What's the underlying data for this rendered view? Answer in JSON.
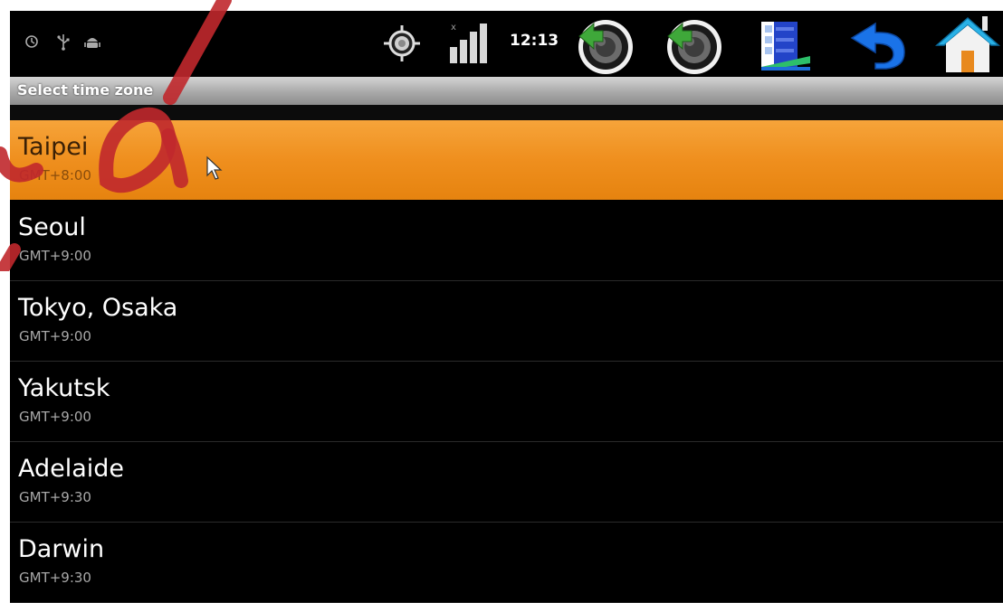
{
  "status_bar": {
    "left_icons": [
      "timer-icon",
      "usb-icon",
      "android-debug-icon"
    ],
    "right_icons": [
      "gps-target-icon",
      "signal-bars-icon"
    ],
    "time": "12:13",
    "actions": [
      "volume-down-icon",
      "volume-up-icon",
      "menu-icon",
      "back-icon",
      "home-icon"
    ]
  },
  "title_bar": {
    "title": "Select time zone"
  },
  "timezones": [
    {
      "name": "Taipei",
      "offset": "GMT+8:00",
      "selected": true
    },
    {
      "name": "Seoul",
      "offset": "GMT+9:00",
      "selected": false
    },
    {
      "name": "Tokyo, Osaka",
      "offset": "GMT+9:00",
      "selected": false
    },
    {
      "name": "Yakutsk",
      "offset": "GMT+9:00",
      "selected": false
    },
    {
      "name": "Adelaide",
      "offset": "GMT+9:30",
      "selected": false
    },
    {
      "name": "Darwin",
      "offset": "GMT+9:30",
      "selected": false
    }
  ],
  "colors": {
    "selection": "#ef8f1e",
    "background": "#000000",
    "title_bar": "#a9a9a9",
    "watermark": "#c0282c"
  }
}
